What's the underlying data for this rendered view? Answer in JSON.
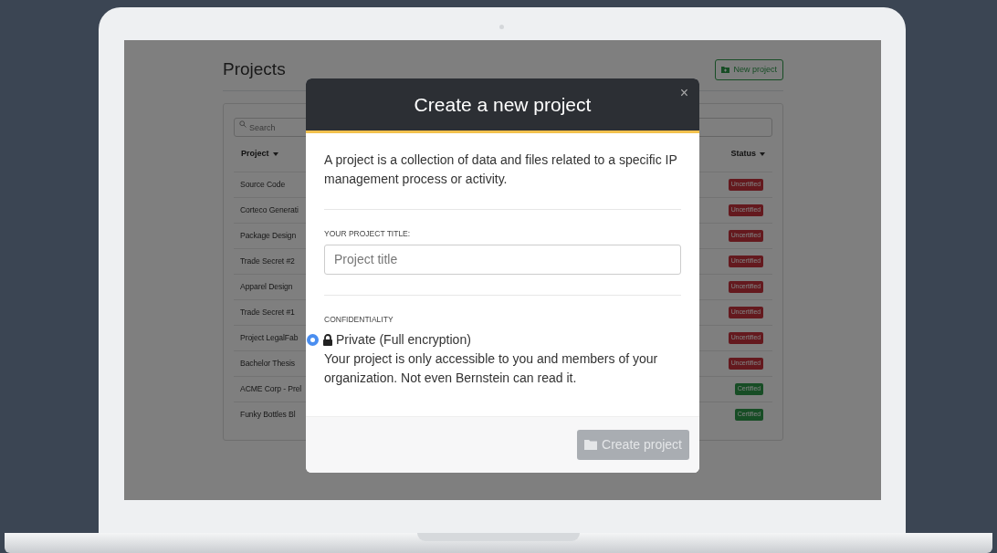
{
  "page": {
    "title": "Projects",
    "new_button": "New project",
    "search": {
      "placeholder": "Search"
    },
    "columns": [
      "Project",
      "Status"
    ],
    "rows": [
      {
        "project": "Source Code",
        "status": "Uncertified",
        "certified": false
      },
      {
        "project": "Corteco Generati",
        "status": "Uncertified",
        "certified": false
      },
      {
        "project": "Package Design",
        "status": "Uncertified",
        "certified": false
      },
      {
        "project": "Trade Secret #2",
        "status": "Uncertified",
        "certified": false
      },
      {
        "project": "Apparel Design",
        "status": "Uncertified",
        "certified": false
      },
      {
        "project": "Trade Secret #1",
        "status": "Uncertified",
        "certified": false
      },
      {
        "project": "Project LegalFab",
        "status": "Uncertified",
        "certified": false
      },
      {
        "project": "Bachelor Thesis",
        "status": "Uncertified",
        "certified": false
      },
      {
        "project": "ACME Corp - Prel",
        "status": "Certified",
        "certified": true
      },
      {
        "project": "Funky Bottles Bl",
        "status": "Certified",
        "certified": true
      }
    ]
  },
  "modal": {
    "title": "Create a new project",
    "close": "×",
    "intro": "A project is a collection of data and files related to a specific IP management process or activity.",
    "title_label": "YOUR PROJECT TITLE:",
    "title_field": {
      "placeholder": "Project title"
    },
    "confidentiality_label": "CONFIDENTIALITY",
    "options": [
      {
        "label": "Private (Full encryption)",
        "description": "Your project is only accessible to you and members of your organization. Not even Bernstein can read it.",
        "selected": true
      }
    ],
    "submit": {
      "label": "Create project",
      "disabled": true
    }
  }
}
